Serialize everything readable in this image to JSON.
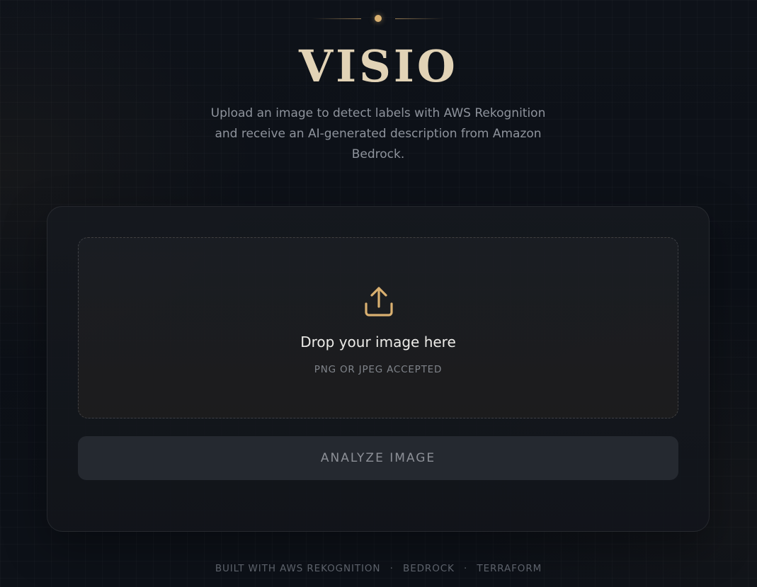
{
  "header": {
    "title": "VISIO",
    "subtitle": "Upload an image to detect labels with AWS Rekognition and receive an AI-generated description from Amazon Bedrock."
  },
  "dropzone": {
    "icon": "upload-icon",
    "title": "Drop your image here",
    "hint": "PNG OR JPEG ACCEPTED"
  },
  "actions": {
    "analyze_label": "ANALYZE IMAGE"
  },
  "footer": {
    "items": [
      "BUILT WITH AWS REKOGNITION",
      "BEDROCK",
      "TERRAFORM"
    ],
    "separator": "·"
  },
  "colors": {
    "accent": "#d9b070",
    "title": "#e2d3b6",
    "background": "#0d1118",
    "card": "#16191f",
    "button": "#252930"
  }
}
